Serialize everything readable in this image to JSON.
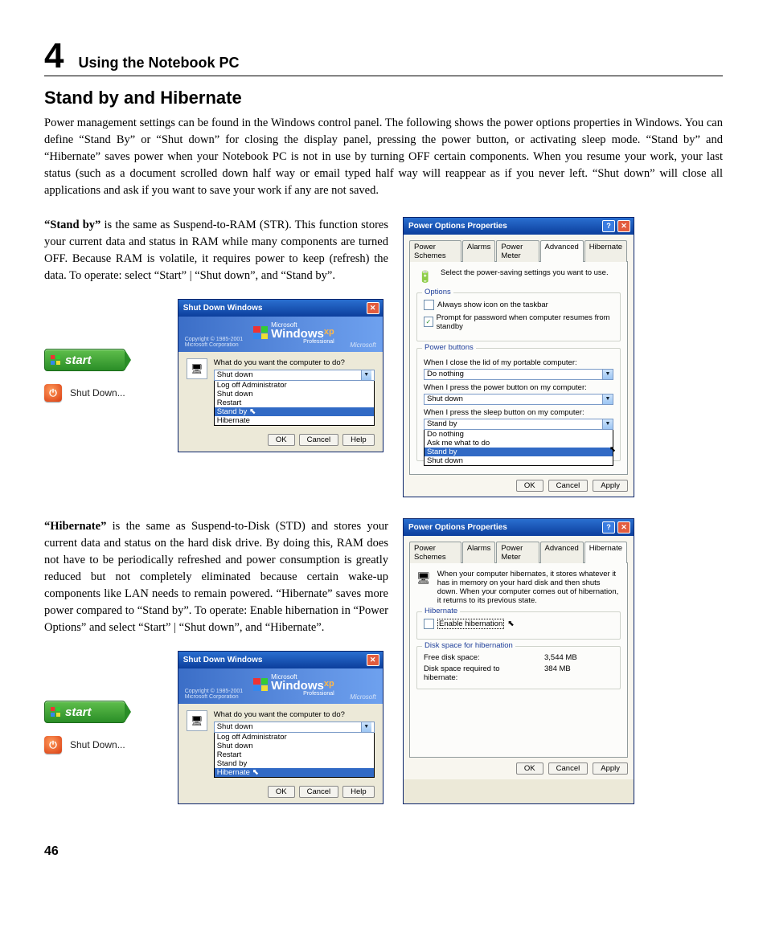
{
  "chapter": {
    "number": "4",
    "title": "Using the Notebook PC"
  },
  "section_title": "Stand by and Hibernate",
  "intro": "Power management settings can be found in the Windows control panel. The following shows the power options properties in Windows. You can define “Stand By” or “Shut down” for closing the display panel, pressing the power button, or activating sleep mode. “Stand by” and “Hibernate” saves power when your Notebook PC is not in use by turning OFF certain components. When you resume your work, your last status (such as a document scrolled down half way or email typed half way will reappear as if you never left. “Shut down” will close all applications and ask if you want to save your work if any are not saved.",
  "standby": {
    "bold": "“Stand by”",
    "text": " is the same as Suspend-to-RAM (STR). This function stores your current data and status in RAM while many components are turned OFF. Because RAM is volatile, it requires power to keep (refresh) the data. To operate: select “Start” | “Shut down”, and “Stand by”."
  },
  "hibernate": {
    "bold": "“Hibernate”",
    "text": " is the same as  Suspend-to-Disk (STD) and stores your current data and status on the hard disk drive. By doing this, RAM does not have to be periodically refreshed and power consumption is greatly reduced but not completely eliminated because certain wake-up components like LAN needs to remain powered. “Hibernate” saves more power compared to “Stand by”. To operate: Enable hibernation in “Power Options” and select “Start” | “Shut down”, and “Hibernate”."
  },
  "start_label": "start",
  "shutdown_label": "Shut Down...",
  "shutdown_dialog": {
    "title": "Shut Down Windows",
    "brand_big": "Windows",
    "brand_small": "Microsoft",
    "brand_xp": "xp",
    "brand_prof": "Professional",
    "copyright1": "Copyright © 1985-2001",
    "copyright2": "Microsoft Corporation",
    "ms": "Microsoft",
    "prompt": "What do you want the computer to do?",
    "selected": "Shut down",
    "options": [
      "Log off Administrator",
      "Shut down",
      "Restart",
      "Stand by",
      "Hibernate"
    ],
    "btn_ok": "OK",
    "btn_cancel": "Cancel",
    "btn_help": "Help"
  },
  "pop1": {
    "title": "Power Options Properties",
    "tabs": [
      "Power Schemes",
      "Alarms",
      "Power Meter",
      "Advanced",
      "Hibernate"
    ],
    "active_tab": "Advanced",
    "intro": "Select the power-saving settings you want to use.",
    "options_group": "Options",
    "opt_taskbar": "Always show icon on the taskbar",
    "opt_password": "Prompt for password when computer resumes from standby",
    "buttons_group": "Power buttons",
    "lid_label": "When I close the lid of my portable computer:",
    "lid_value": "Do nothing",
    "power_label": "When I press the power button on my computer:",
    "power_value": "Shut down",
    "sleep_label": "When I press the sleep button on my computer:",
    "sleep_value": "Stand by",
    "sleep_options": [
      "Do nothing",
      "Ask me what to do",
      "Stand by",
      "Shut down"
    ],
    "btn_ok": "OK",
    "btn_cancel": "Cancel",
    "btn_apply": "Apply"
  },
  "pop2": {
    "title": "Power Options Properties",
    "tabs": [
      "Power Schemes",
      "Alarms",
      "Power Meter",
      "Advanced",
      "Hibernate"
    ],
    "active_tab": "Hibernate",
    "intro": "When your computer hibernates, it stores whatever it has in memory on your hard disk and then shuts down. When your computer comes out of hibernation, it returns to its previous state.",
    "hib_group": "Hibernate",
    "enable_hib": "Enable hibernation",
    "disk_group": "Disk space for hibernation",
    "free_label": "Free disk space:",
    "free_value": "3,544 MB",
    "req_label": "Disk space required to hibernate:",
    "req_value": "384 MB",
    "btn_ok": "OK",
    "btn_cancel": "Cancel",
    "btn_apply": "Apply"
  },
  "page_number": "46"
}
